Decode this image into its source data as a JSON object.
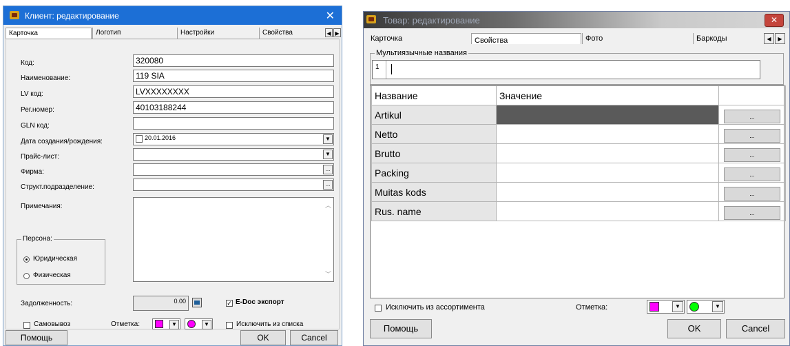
{
  "client_window": {
    "title": "Клиент: редактирование",
    "tabs": [
      "Карточка",
      "Логотип",
      "Настройки",
      "Свойства"
    ],
    "fields": {
      "code_label": "Код:",
      "code_value": "320080",
      "name_label": "Наименование:",
      "name_value": "119 SIA",
      "lv_label": "LV код:",
      "lv_value": "LVXXXXXXXX",
      "reg_label": "Рег.номер:",
      "reg_value": "40103188244",
      "gln_label": "GLN код:",
      "gln_value": "",
      "date_label": "Дата создания/рождения:",
      "date_value": "20.01.2016",
      "price_label": "Прайс-лист:",
      "price_value": "",
      "firm_label": "Фирма:",
      "firm_value": "",
      "struct_label": "Структ.подразделение:",
      "struct_value": "",
      "notes_label": "Примечания:"
    },
    "person": {
      "title": "Персона:",
      "legal": "Юридическая",
      "physical": "Физическая",
      "selected": "legal"
    },
    "debt_label": "Задолженность:",
    "debt_value": "0.00",
    "edoc_label": "E-Doc экспорт",
    "edoc_checked": true,
    "pickup_label": "Самовывоз",
    "mark_label": "Отметка:",
    "exclude_label": "Исключить из списка",
    "help_button": "Помощь",
    "ok_button": "OK",
    "cancel_button": "Cancel",
    "colors": {
      "title_bar": "#1c6fd6",
      "mark_square": "#ff00ff",
      "mark_circle": "#ff00ff"
    }
  },
  "goods_window": {
    "title": "Товар: редактирование",
    "tabs": [
      "Карточка",
      "Свойства",
      "Фото",
      "Баркоды"
    ],
    "multilang_label": "Мультиязычные названия",
    "multilang_index": "1",
    "grid_headers": [
      "Название",
      "Значение",
      ""
    ],
    "grid_rows": [
      "Artikul",
      "Netto",
      "Brutto",
      "Packing",
      "Muitas kods",
      "Rus. name"
    ],
    "ellipsis": "...",
    "exclude_label": "Исключить из ассортимента",
    "mark_label": "Отметка:",
    "help_button": "Помощь",
    "ok_button": "OK",
    "cancel_button": "Cancel",
    "colors": {
      "mark_square": "#ff00ff",
      "mark_circle": "#00ff00",
      "selected_cell": "#5a5a5a"
    }
  }
}
